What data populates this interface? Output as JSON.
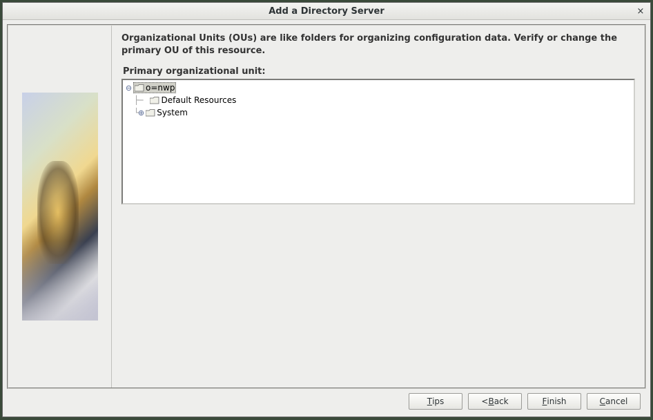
{
  "titlebar": {
    "title": "Add a Directory Server"
  },
  "main": {
    "description": "Organizational Units (OUs) are like folders for organizing configuration data.  Verify or change the primary OU of this resource.",
    "tree_label": "Primary organizational unit:",
    "tree": {
      "root": "o=nwp",
      "child1": "Default Resources",
      "child2": "System"
    }
  },
  "buttons": {
    "tips_pre": "",
    "tips_mn": "T",
    "tips_post": "ips",
    "back_pre": "<",
    "back_mn": "B",
    "back_post": "ack",
    "finish_pre": "",
    "finish_mn": "F",
    "finish_post": "inish",
    "cancel_pre": "",
    "cancel_mn": "C",
    "cancel_post": "ancel"
  }
}
